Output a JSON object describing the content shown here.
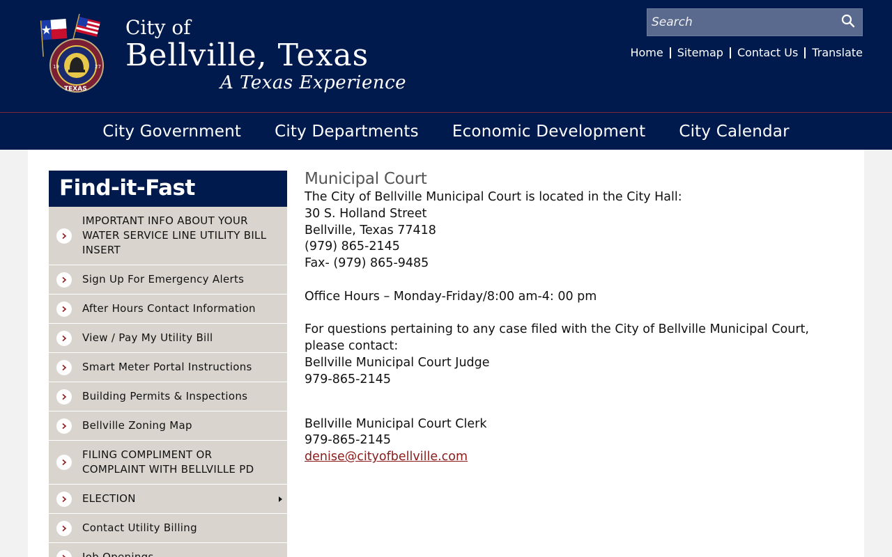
{
  "header": {
    "city_of": "City of",
    "city_name": "Bellville, Texas",
    "tagline": "A Texas Experience",
    "badge_top_text": "CITY OF BELLVILLE",
    "badge_bottom_text": "TEXAS",
    "badge_year_left": "19",
    "badge_year_right": "27",
    "search": {
      "placeholder": "Search"
    },
    "utility_links": [
      "Home",
      "Sitemap",
      "Contact Us",
      "Translate"
    ]
  },
  "main_nav": [
    "City Government",
    "City Departments",
    "Economic Development",
    "City Calendar"
  ],
  "sidebar": {
    "title": "Find-it-Fast",
    "items": [
      {
        "label": "IMPORTANT INFO ABOUT YOUR WATER SERVICE LINE UTILITY BILL INSERT"
      },
      {
        "label": "Sign Up For Emergency Alerts"
      },
      {
        "label": "After Hours Contact Information"
      },
      {
        "label": "View / Pay My Utility Bill"
      },
      {
        "label": "Smart Meter Portal Instructions"
      },
      {
        "label": "Building Permits & Inspections"
      },
      {
        "label": "Bellville Zoning Map"
      },
      {
        "label": "FILING COMPLIMENT OR COMPLAINT WITH BELLVILLE PD"
      },
      {
        "label": "ELECTION",
        "has_submenu": true
      },
      {
        "label": "Contact Utility Billing"
      },
      {
        "label": "Job Openings"
      }
    ]
  },
  "content": {
    "title": "Municipal Court",
    "lines_1": [
      "The City of Bellville Municipal Court is located in the City Hall:",
      "30 S. Holland Street",
      "Bellville, Texas 77418",
      "(979) 865-2145",
      "Fax- (979) 865-9485"
    ],
    "office_hours": "Office Hours – Monday-Friday/8:00 am-4: 00 pm",
    "questions_1": "For questions pertaining to any case filed with the City of Bellville Municipal Court,",
    "questions_2": "please contact:",
    "judge_title": "Bellville Municipal Court Judge",
    "judge_phone": "979-865-2145",
    "clerk_title": "Bellville Municipal Court Clerk",
    "clerk_phone": "979-865-2145",
    "clerk_email": "denise@cityofbellville.com"
  },
  "colors": {
    "navy": "#001a4d",
    "sidebar_bg": "#d9d5ce",
    "accent_red": "#8b1a1a"
  }
}
